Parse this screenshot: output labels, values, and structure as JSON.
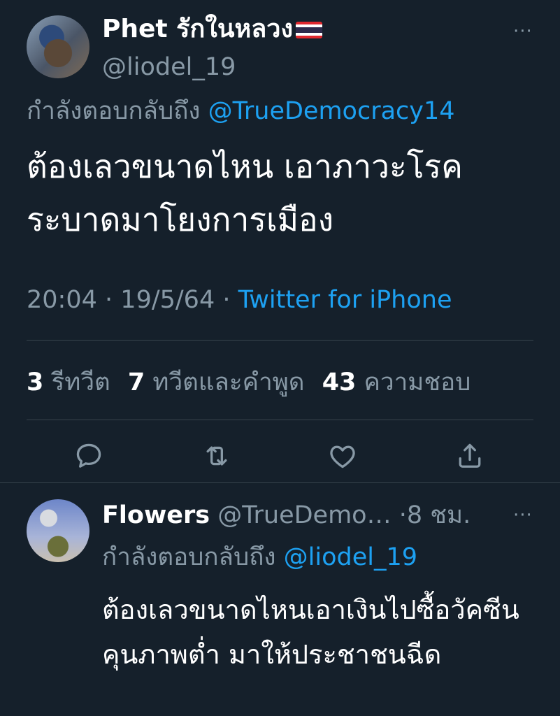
{
  "main_tweet": {
    "display_name": "Phet รักในหลวง",
    "flag_emoji": "thai-flag-icon",
    "handle": "@liodel_19",
    "replying_label": "กำลังตอบกลับถึง",
    "replying_to": "@TrueDemocracy14",
    "text": "ต้องเลวขนาดไหน เอาภาวะโรคระบาดมาโยงการเมือง",
    "time": "20:04",
    "date": "19/5/64",
    "source": "Twitter for iPhone",
    "retweets_count": "3",
    "retweets_label": "รีทวีต",
    "quotes_count": "7",
    "quotes_label": "ทวีตและคำพูด",
    "likes_count": "43",
    "likes_label": "ความชอบ",
    "more_label": "···"
  },
  "actions": [
    {
      "icon": "reply-icon"
    },
    {
      "icon": "retweet-icon"
    },
    {
      "icon": "like-icon"
    },
    {
      "icon": "share-icon"
    }
  ],
  "reply_tweet": {
    "display_name": "Flowers",
    "handle": "@TrueDemo…",
    "time_ago": "·8 ชม.",
    "replying_label": "กำลังตอบกลับถึง",
    "replying_to": "@liodel_19",
    "text": "ต้องเลวขนาดไหนเอาเงินไปซื้อวัคซีนคุนภาพต่ำ มาให้ประชาชนฉีด",
    "more_label": "···"
  },
  "colors": {
    "background": "#15202b",
    "secondary_text": "#8899a6",
    "link": "#1da1f2",
    "divider": "#38444d"
  }
}
